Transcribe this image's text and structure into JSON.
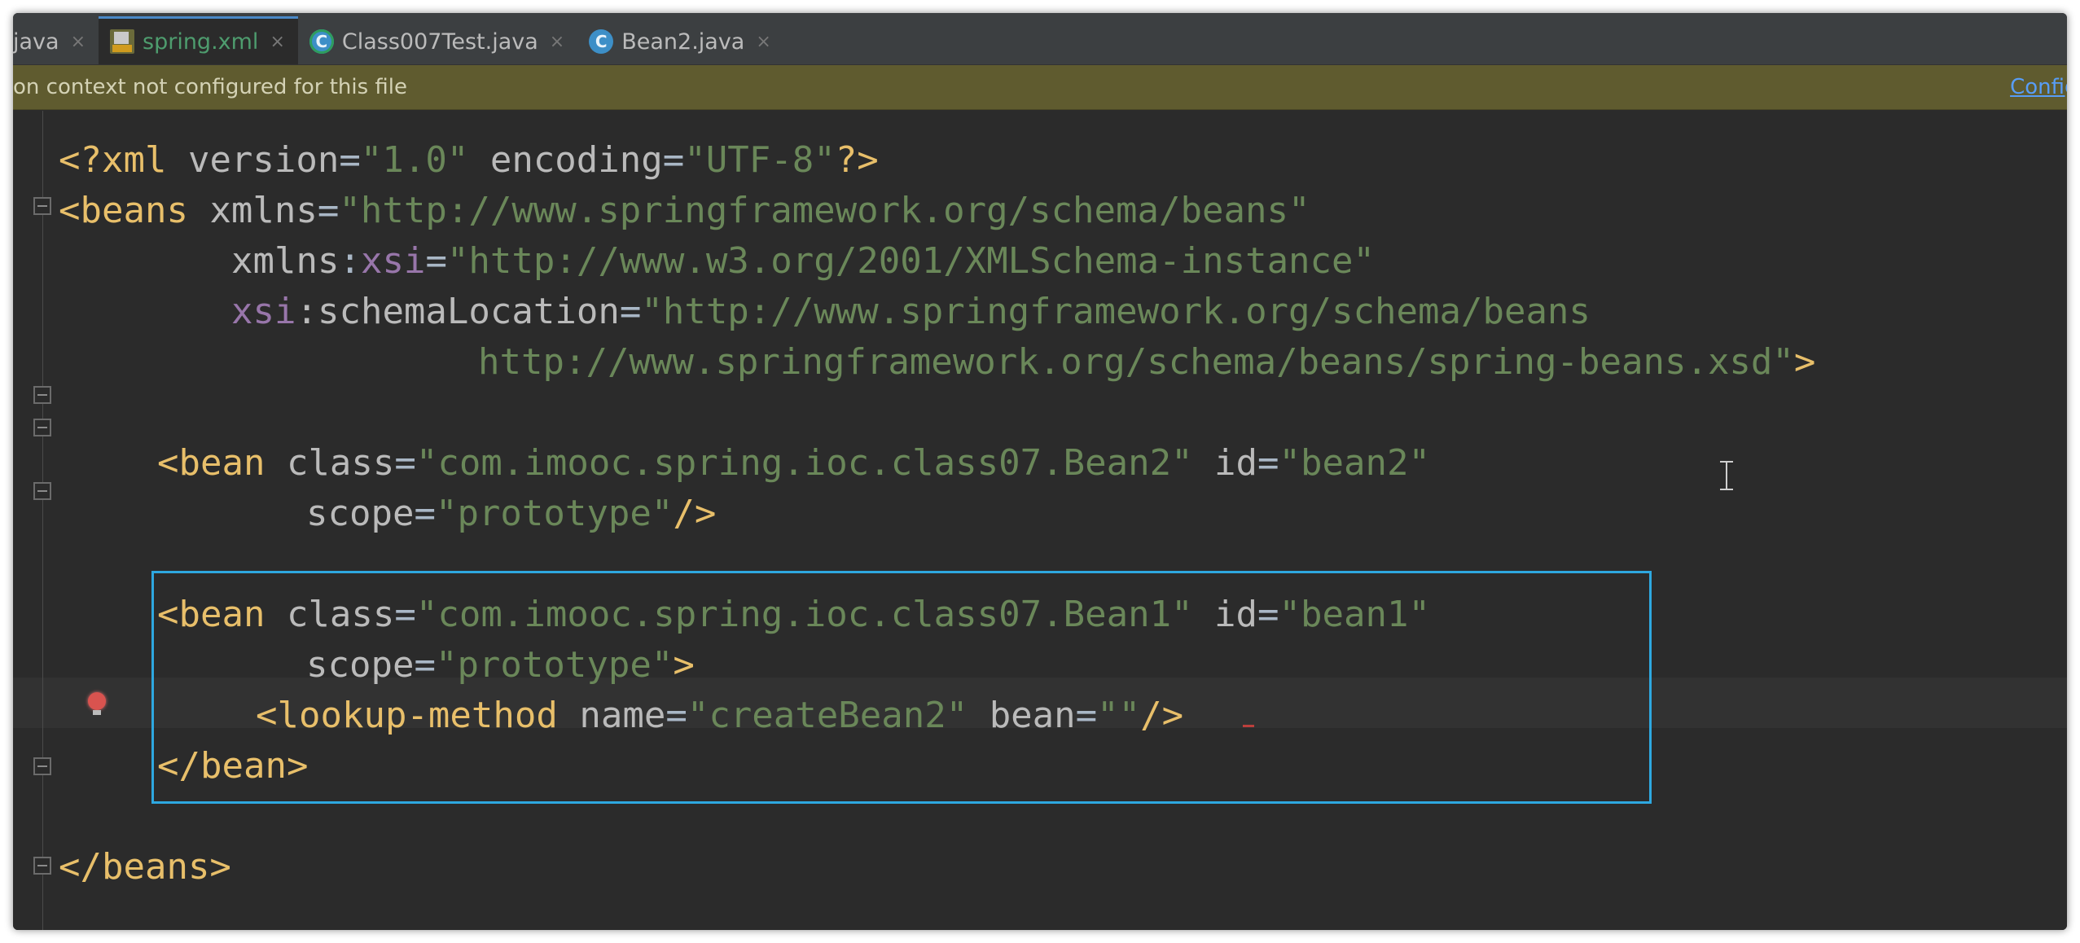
{
  "tabs": [
    {
      "label": "java",
      "icon": "none",
      "active": false
    },
    {
      "label": "spring.xml",
      "icon": "xml-file-icon",
      "active": true
    },
    {
      "label": "Class007Test.java",
      "icon": "java-class-icon",
      "active": false
    },
    {
      "label": "Bean2.java",
      "icon": "java-class-icon",
      "active": false
    }
  ],
  "tab_close_glyph": "×",
  "notification": {
    "message": "on context not configured for this file",
    "action": "Configu"
  },
  "code": {
    "l1": {
      "a": "<?xml ",
      "b": "version",
      "c": "=",
      "d": "\"1.0\"",
      "e": " encoding",
      "f": "=",
      "g": "\"UTF-8\"",
      "h": "?>"
    },
    "l2": {
      "a": "<beans ",
      "b": "xmlns",
      "c": "=",
      "d": "\"http://www.springframework.org/schema/beans\""
    },
    "l3": {
      "a": "xmlns",
      "b": ":",
      "c": "xsi",
      "d": "=",
      "e": "\"http://www.w3.org/2001/XMLSchema-instance\""
    },
    "l4": {
      "a": "xsi",
      "b": ":schemaLocation",
      "c": "=",
      "d": "\"http://www.springframework.org/schema/beans"
    },
    "l5": {
      "a": "http://www.springframework.org/schema/beans/spring-beans.xsd\"",
      "b": ">"
    },
    "l7": {
      "a": "<bean ",
      "b": "class",
      "c": "=",
      "d": "\"com.imooc.spring.ioc.class07.Bean2\"",
      "e": " id",
      "f": "=",
      "g": "\"bean2\""
    },
    "l8": {
      "a": "scope",
      "b": "=",
      "c": "\"prototype\"",
      "d": "/>"
    },
    "l10": {
      "a": "<bean ",
      "b": "class",
      "c": "=",
      "d": "\"com.imooc.spring.ioc.class07.Bean1\"",
      "e": " id",
      "f": "=",
      "g": "\"bean1\""
    },
    "l11": {
      "a": "scope",
      "b": "=",
      "c": "\"prototype\"",
      "d": ">"
    },
    "l12": {
      "a": "<lookup-method ",
      "b": "name",
      "c": "=",
      "d": "\"createBean2\"",
      "e": " bean",
      "f": "=",
      "g": "\"\"",
      "h": "/>"
    },
    "l13": {
      "a": "</bean>"
    },
    "l15": {
      "a": "</beans>"
    }
  },
  "colors": {
    "tag": "#e8bf6a",
    "attribute": "#bababa",
    "namespace": "#9876aa",
    "string": "#6a8759",
    "highlight_box": "#2ea8e0",
    "notification_bg": "#5f5b2f"
  }
}
